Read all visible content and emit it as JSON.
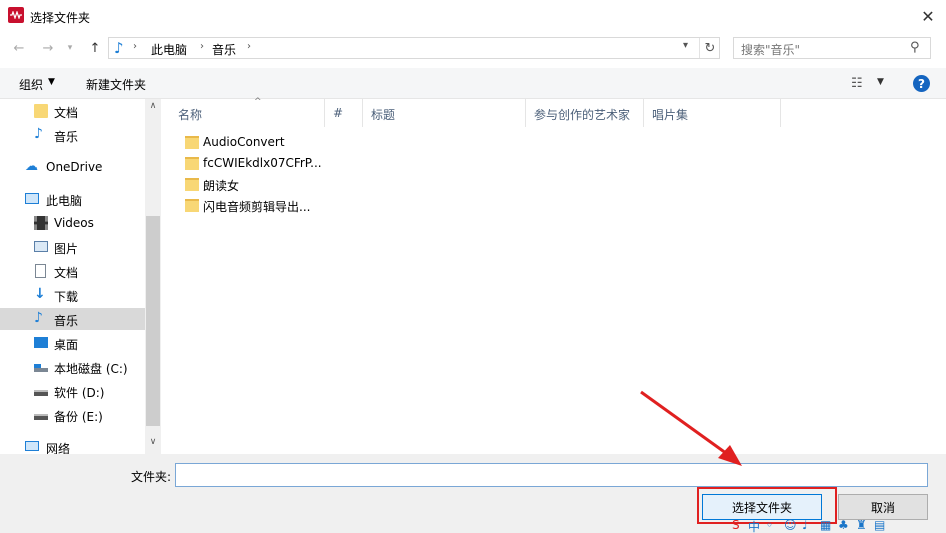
{
  "window": {
    "title": "选择文件夹"
  },
  "address": {
    "crumbs": [
      "此电脑",
      "音乐"
    ],
    "search_placeholder": "搜索\"音乐\""
  },
  "toolbar": {
    "organize": "组织",
    "new_folder": "新建文件夹"
  },
  "nav": {
    "items": [
      {
        "label": "文档"
      },
      {
        "label": "音乐"
      },
      {
        "label": "OneDrive"
      },
      {
        "label": "此电脑"
      },
      {
        "label": "Videos"
      },
      {
        "label": "图片"
      },
      {
        "label": "文档"
      },
      {
        "label": "下载"
      },
      {
        "label": "音乐"
      },
      {
        "label": "桌面"
      },
      {
        "label": "本地磁盘 (C:)"
      },
      {
        "label": "软件 (D:)"
      },
      {
        "label": "备份 (E:)"
      },
      {
        "label": "网络"
      }
    ]
  },
  "columns": [
    "名称",
    "#",
    "标题",
    "参与创作的艺术家",
    "唱片集"
  ],
  "files": [
    "AudioConvert",
    "fcCWIEkdlx07CFrP...",
    "朗读女",
    "闪电音频剪辑导出..."
  ],
  "bottom": {
    "folder_label": "文件夹:",
    "folder_value": "",
    "select_button": "选择文件夹",
    "cancel_button": "取消"
  },
  "colors": {
    "accent": "#0078d7",
    "annotation": "#e02020",
    "selected": "#d9d9d9"
  }
}
